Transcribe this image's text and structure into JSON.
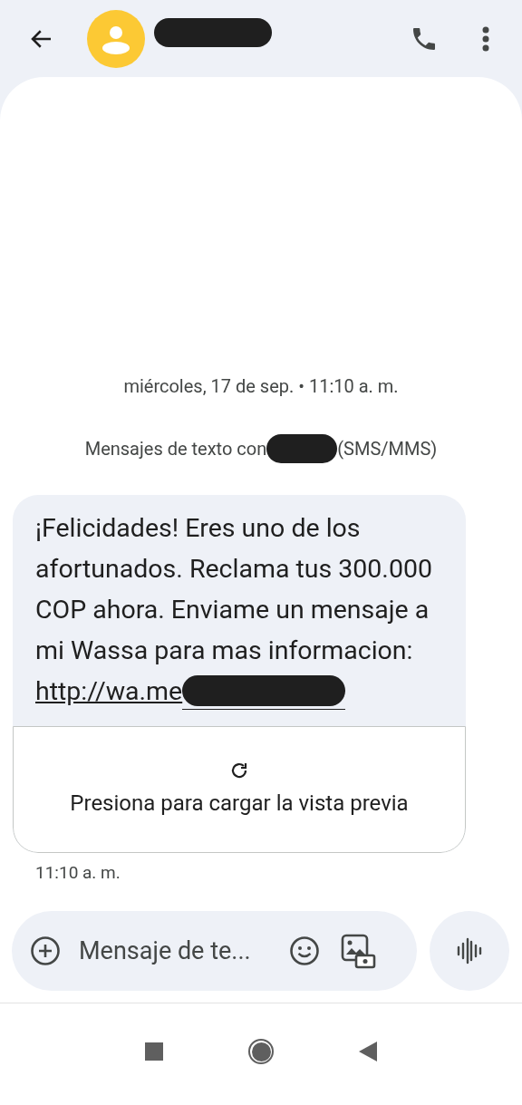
{
  "header": {
    "contact_redacted": true
  },
  "conversation": {
    "date": "miércoles, 17 de sep. • 11:10 a. m.",
    "info_prefix": "Mensajes de texto con",
    "info_suffix": "(SMS/MMS)"
  },
  "message": {
    "text": "¡Felicidades! Eres uno de los afortunados. Reclama tus 300.000 COP ahora. Enviame un mensaje a mi Wassa para mas informacion:",
    "link": "http://wa.me",
    "preview_label": "Presiona para cargar la vista previa",
    "time": "11:10 a. m."
  },
  "composer": {
    "placeholder": "Mensaje de te..."
  }
}
